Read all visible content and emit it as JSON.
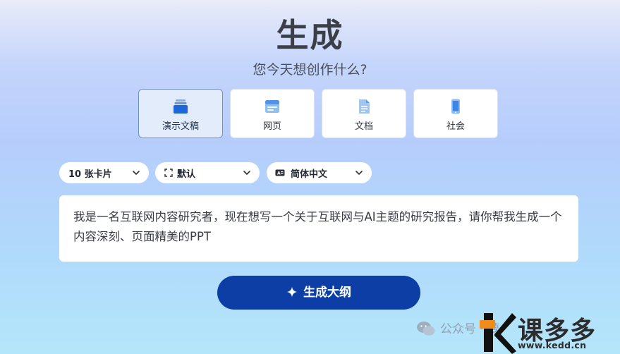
{
  "header": {
    "title": "生成",
    "subtitle": "您今天想创作什么?"
  },
  "content_types": [
    {
      "label": "演示文稿",
      "icon": "presentation-stack-icon",
      "selected": true
    },
    {
      "label": "网页",
      "icon": "webpage-icon",
      "selected": false
    },
    {
      "label": "文档",
      "icon": "document-icon",
      "selected": false
    },
    {
      "label": "社会",
      "icon": "mobile-phone-icon",
      "selected": false
    }
  ],
  "options": {
    "card_count": {
      "label": "10 张卡片"
    },
    "theme": {
      "label": "默认",
      "icon": "layout-frame-icon"
    },
    "language": {
      "label": "简体中文",
      "icon": "language-badge-icon"
    }
  },
  "prompt": {
    "value": "我是一名互联网内容研究者，现在想写一个关于互联网与AI主题的研究报告，请你帮我生成一个内容深刻、页面精美的PPT"
  },
  "generate_button": {
    "label": "生成大纲",
    "icon": "sparkle-icon"
  },
  "watermark": {
    "text": "公众号 · 萝"
  },
  "logo": {
    "text": "课多多",
    "url": "www.kedd.cn"
  },
  "colors": {
    "primary_button": "#0c3ea6",
    "icon_blue": "#2f7be6",
    "selected_card_bg": "#e2ecfb",
    "logo_orange": "#f08c1a"
  }
}
